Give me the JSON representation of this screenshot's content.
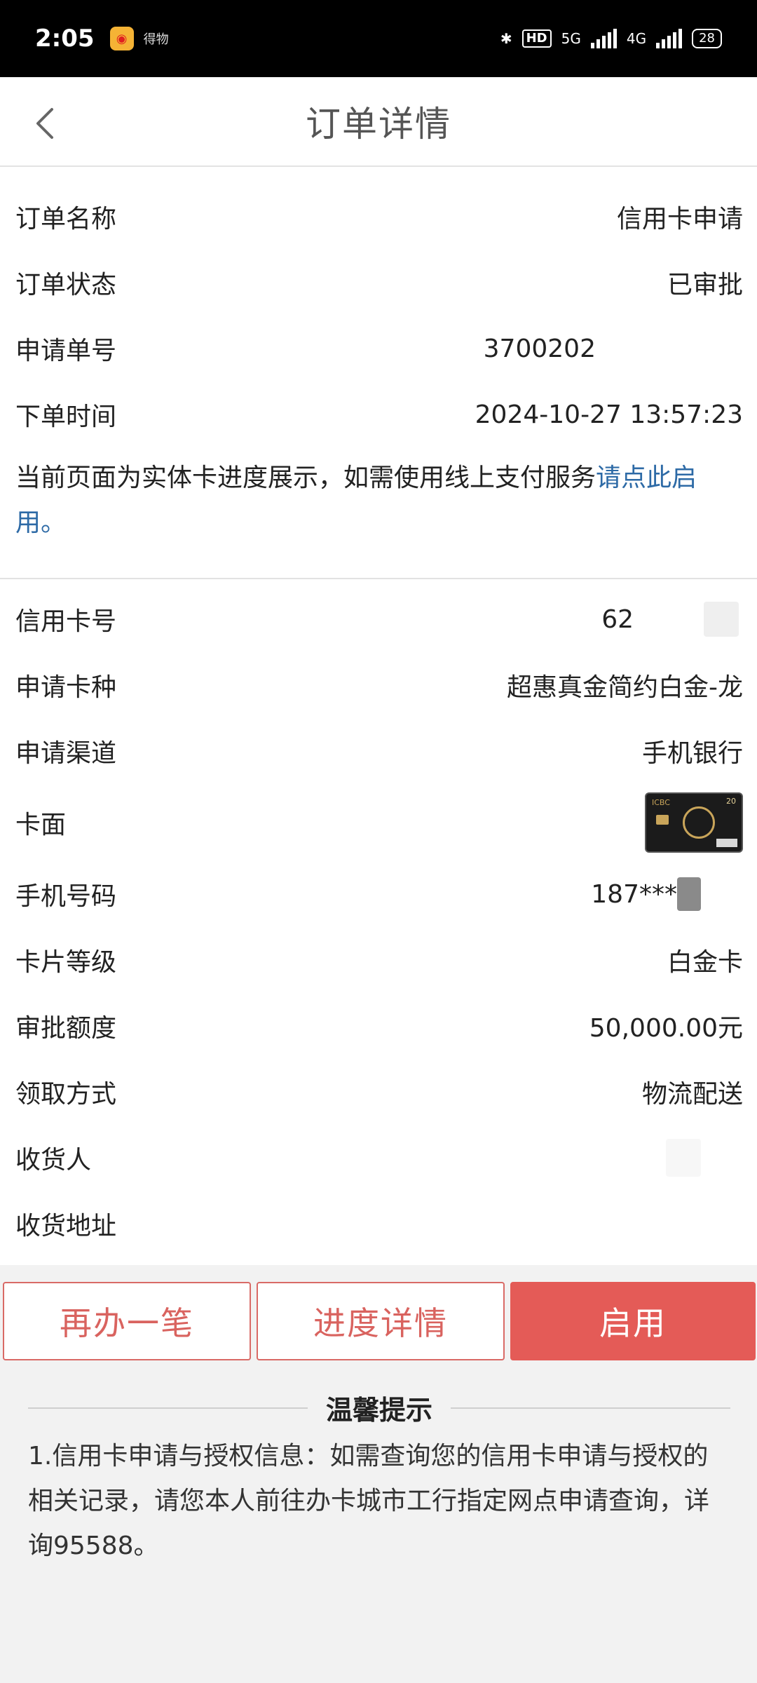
{
  "status_bar": {
    "time": "2:05",
    "app_label": "得物",
    "network1": "5G",
    "network2": "4G",
    "hd": "HD",
    "battery": "28"
  },
  "header": {
    "title": "订单详情"
  },
  "order": {
    "rows": [
      {
        "label": "订单名称",
        "value": "信用卡申请"
      },
      {
        "label": "订单状态",
        "value": "已审批"
      },
      {
        "label": "申请单号",
        "value": "3700202"
      },
      {
        "label": "下单时间",
        "value": "2024-10-27 13:57:23"
      }
    ],
    "notice_text": "当前页面为实体卡进度展示，如需使用线上支付服务",
    "notice_link": "请点此启用。"
  },
  "card": {
    "card_number_label": "信用卡号",
    "card_number_value": "62",
    "card_type_label": "申请卡种",
    "card_type_value": "超惠真金简约白金-龙",
    "channel_label": "申请渠道",
    "channel_value": "手机银行",
    "face_label": "卡面",
    "face_logo": "ICBC",
    "face_number": "20",
    "phone_label": "手机号码",
    "phone_value": "187***",
    "level_label": "卡片等级",
    "level_value": "白金卡",
    "limit_label": "审批额度",
    "limit_value": "50,000.00元",
    "delivery_label": "领取方式",
    "delivery_value": "物流配送",
    "receiver_label": "收货人",
    "address_label": "收货地址"
  },
  "buttons": {
    "again": "再办一笔",
    "progress": "进度详情",
    "activate": "启用"
  },
  "tips": {
    "title": "温馨提示",
    "body": "1.信用卡申请与授权信息：如需查询您的信用卡申请与授权的相关记录，请您本人前往办卡城市工行指定网点申请查询，详询95588。"
  }
}
